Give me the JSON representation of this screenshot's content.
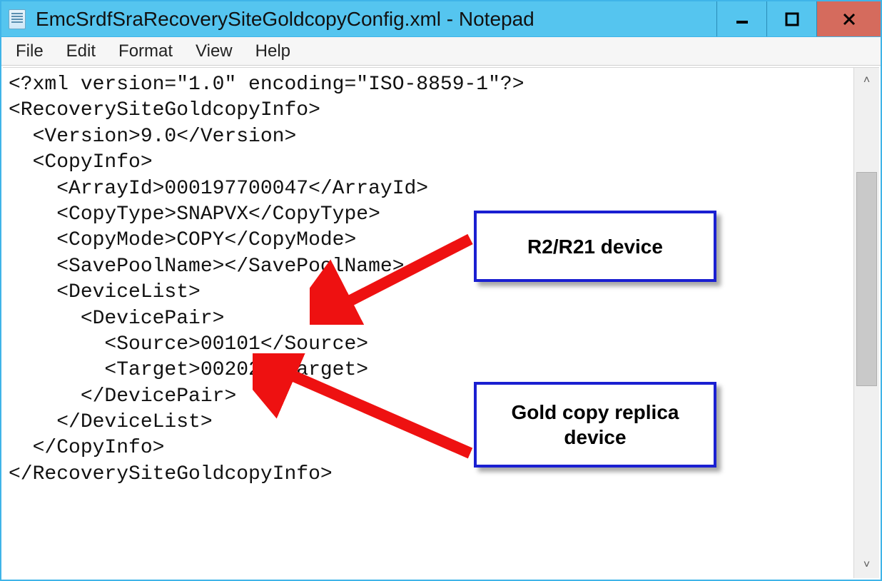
{
  "window": {
    "title": "EmcSrdfSraRecoverySiteGoldcopyConfig.xml - Notepad"
  },
  "menu": {
    "file": "File",
    "edit": "Edit",
    "format": "Format",
    "view": "View",
    "help": "Help"
  },
  "editor_text": "<?xml version=\"1.0\" encoding=\"ISO-8859-1\"?>\n<RecoverySiteGoldcopyInfo>\n  <Version>9.0</Version>\n  <CopyInfo>\n    <ArrayId>000197700047</ArrayId>\n    <CopyType>SNAPVX</CopyType>\n    <CopyMode>COPY</CopyMode>\n    <SavePoolName></SavePoolName>\n    <DeviceList>\n      <DevicePair>\n        <Source>00101</Source>\n        <Target>00202</Target>\n      </DevicePair>\n    </DeviceList>\n  </CopyInfo>\n</RecoverySiteGoldcopyInfo>",
  "annotations": {
    "callout1": "R2/R21 device",
    "callout2": "Gold copy replica device"
  }
}
